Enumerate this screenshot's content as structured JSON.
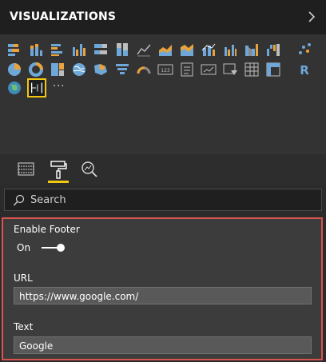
{
  "header": {
    "title": "VISUALIZATIONS",
    "collapse_icon": "chevron-right-icon"
  },
  "gallery": {
    "icons": [
      "stacked-bar-chart-icon",
      "stacked-column-chart-icon",
      "clustered-bar-chart-icon",
      "clustered-column-chart-icon",
      "100-percent-stacked-bar-chart-icon",
      "100-percent-stacked-column-chart-icon",
      "line-chart-icon",
      "area-chart-icon",
      "stacked-area-chart-icon",
      "line-and-stacked-column-chart-icon",
      "line-and-clustered-column-chart-icon",
      "ribbon-chart-icon",
      "waterfall-chart-icon",
      "scatter-chart-icon",
      "pie-chart-icon",
      "donut-chart-icon",
      "treemap-icon",
      "map-icon",
      "filled-map-icon",
      "funnel-icon",
      "gauge-icon",
      "card-icon",
      "multi-row-card-icon",
      "kpi-icon",
      "slicer-icon",
      "table-icon",
      "matrix-icon",
      "r-script-visual-icon",
      "globe-map-icon",
      "custom-footer-visual-icon"
    ],
    "more_label": "···",
    "selected_icon": "custom-footer-visual-icon"
  },
  "pane_tabs": [
    {
      "icon": "fields-icon",
      "active": false
    },
    {
      "icon": "format-paint-roller-icon",
      "active": true
    },
    {
      "icon": "analytics-icon",
      "active": false
    }
  ],
  "search": {
    "placeholder": "Search",
    "icon": "search-icon"
  },
  "format": {
    "enable_footer_label": "Enable Footer",
    "toggle_state_label": "On",
    "toggle_on": true,
    "url_label": "URL",
    "url_value": "https://www.google.com/",
    "text_label": "Text",
    "text_value": "Google"
  },
  "colors": {
    "accent": "#f2c811",
    "highlight_border": "#d9534f",
    "chart_blue": "#6ea7d8",
    "chart_orange": "#e8a33d"
  }
}
